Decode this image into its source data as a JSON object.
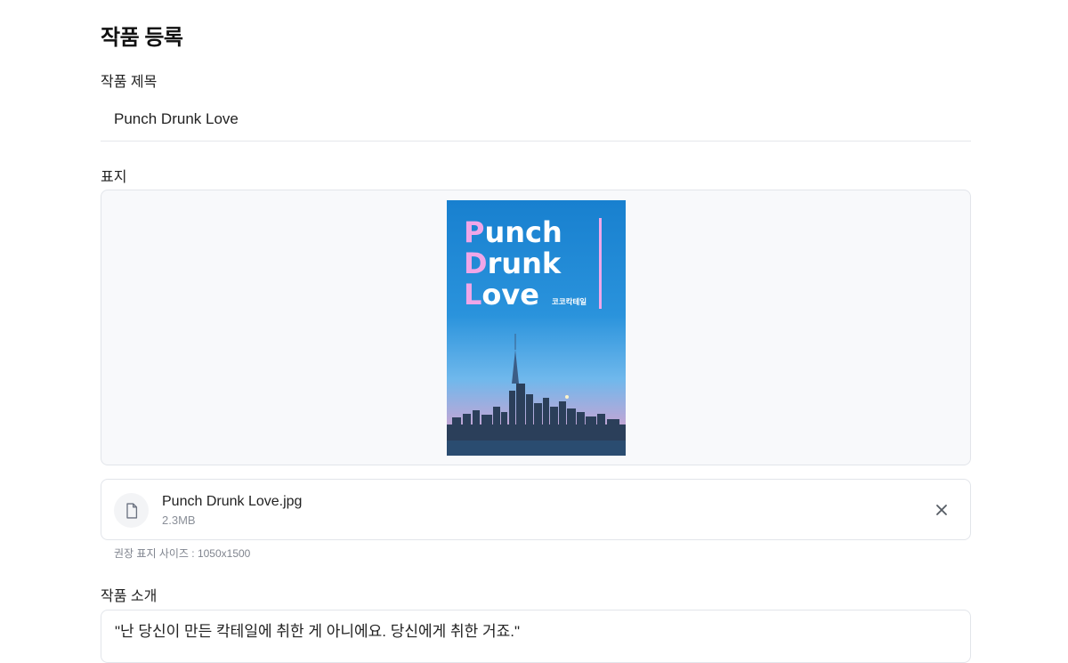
{
  "page": {
    "title": "작품 등록"
  },
  "form": {
    "title_label": "작품 제목",
    "title_value": "Punch Drunk Love",
    "cover_label": "표지",
    "intro_label": "작품 소개",
    "intro_value": "\"난 당신이 만든 칵테일에 취한 게 아니에요. 당신에게 취한 거죠.\""
  },
  "cover": {
    "title_lines": [
      {
        "initial": "P",
        "rest": "unch"
      },
      {
        "initial": "D",
        "rest": "runk"
      },
      {
        "initial": "L",
        "rest": "ove"
      }
    ],
    "author": "코코칵테일",
    "accent_color": "#f0a6e8",
    "sky_color": "#1c86d4"
  },
  "file": {
    "name": "Punch Drunk Love.jpg",
    "size": "2.3MB",
    "icon": "file-icon",
    "remove_icon": "close-icon"
  },
  "hint": "권장 표지 사이즈 : 1050x1500"
}
